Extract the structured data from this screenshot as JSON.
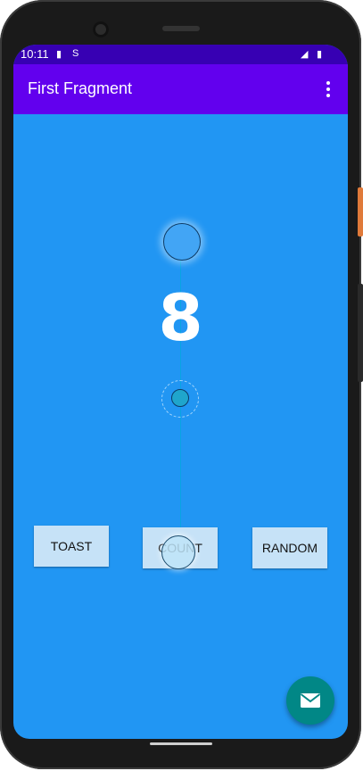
{
  "status_bar": {
    "time": "10:11",
    "left_icons": [
      "sim-icon",
      "sync-icon"
    ],
    "right_icons": [
      "signal-icon",
      "battery-icon"
    ]
  },
  "app_bar": {
    "title": "First Fragment",
    "menu_icon": "overflow-menu-icon"
  },
  "main": {
    "counter_value": "8",
    "buttons": {
      "toast": "TOAST",
      "count": "COUNT",
      "random": "RANDOM"
    }
  },
  "fab": {
    "icon": "email-icon"
  },
  "colors": {
    "status_bar": "#3700B3",
    "app_bar": "#6200EE",
    "background": "#2196F3",
    "button": "#C6E2F7",
    "fab": "#018786"
  }
}
